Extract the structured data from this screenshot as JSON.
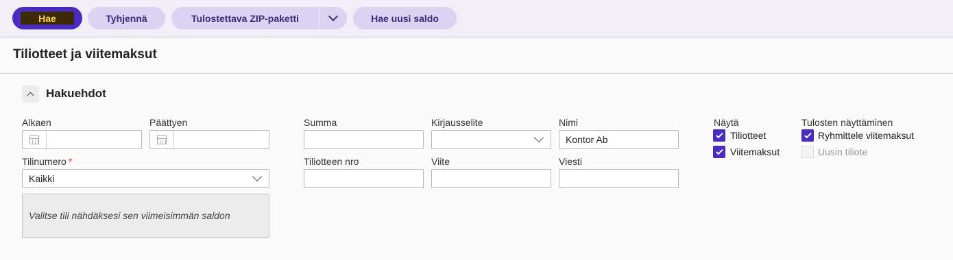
{
  "toolbar": {
    "search_label": "Hae",
    "clear_label": "Tyhjennä",
    "zip_label": "Tulostettava ZIP-paketti",
    "new_balance_label": "Hae uusi saldo"
  },
  "page": {
    "title": "Tiliotteet ja viitemaksut"
  },
  "section": {
    "title": "Hakuehdot"
  },
  "form": {
    "start_label": "Alkaen",
    "start_value": "",
    "end_label": "Päättyen",
    "end_value": "",
    "account_label": "Tilinumero",
    "account_required": "*",
    "account_value": "Kaikki",
    "info_text": "Valitse tili nähdäksesi sen viimeisimmän saldon",
    "sum_label": "Summa",
    "sum_value": "",
    "posting_label": "Kirjausselite",
    "posting_value": "",
    "name_label": "Nimi",
    "name_value": "Kontor Ab",
    "statement_no_label": "Tiliotteen nro",
    "statement_no_value": "",
    "reference_label": "Viite",
    "reference_value": "",
    "message_label": "Viesti",
    "message_value": ""
  },
  "show": {
    "label": "Näytä",
    "statements_label": "Tiliotteet",
    "statements_checked": true,
    "reference_payments_label": "Viitemaksut",
    "reference_payments_checked": true
  },
  "results": {
    "label": "Tulosten näyttäminen",
    "group_label": "Ryhmittele viitemaksut",
    "group_checked": true,
    "newest_label": "Uusin tiliote",
    "newest_checked": false
  },
  "colors": {
    "accent": "#4a2bbf",
    "button_bg": "#dcd3f3",
    "toolbar_bg": "#f1eef8"
  }
}
